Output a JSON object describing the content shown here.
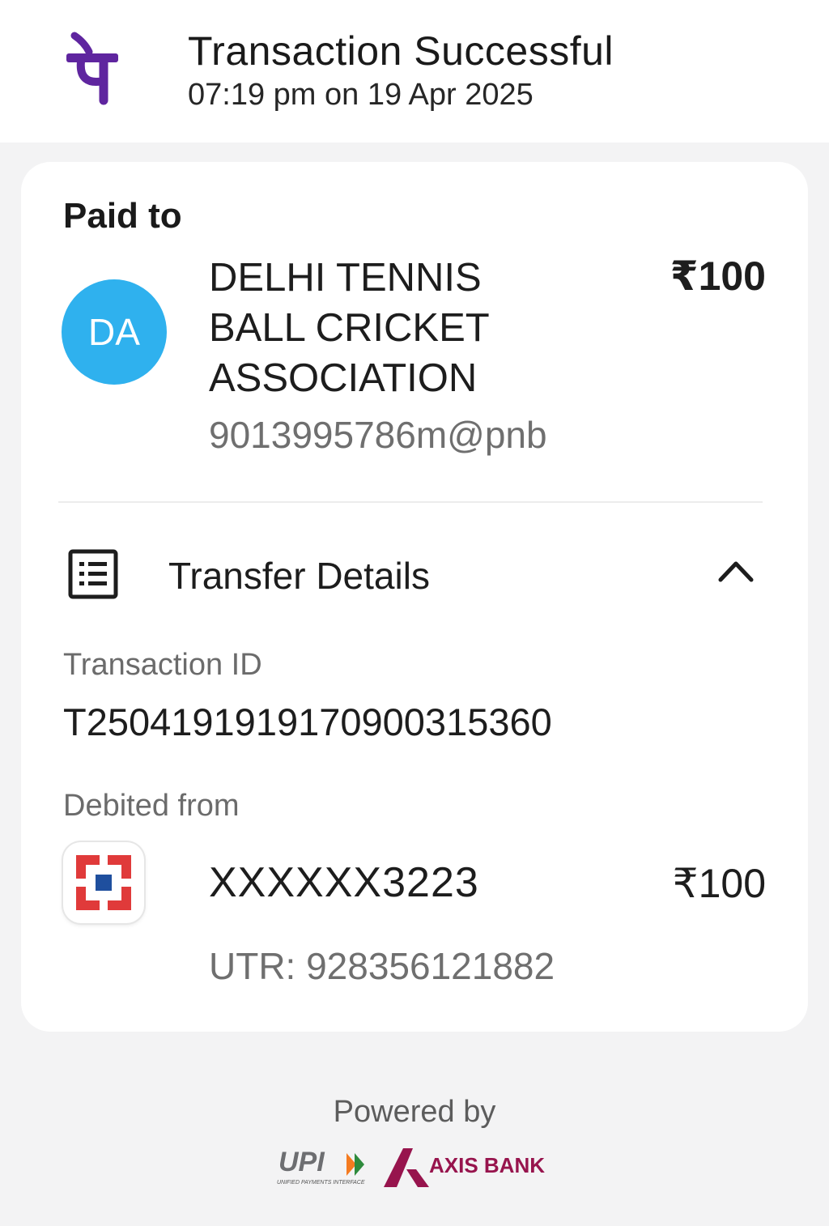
{
  "header": {
    "title": "Transaction Successful",
    "subtitle": "07:19 pm on 19 Apr 2025",
    "logo_icon": "phonepe-logo",
    "brand_color": "#5f259f"
  },
  "payment": {
    "paid_to_label": "Paid to",
    "avatar_initials": "DA",
    "avatar_color": "#2fb1ee",
    "payee_name": "DELHI TENNIS BALL CRICKET ASSOCIATION",
    "payee_upi": "9013995786m@pnb",
    "amount": "₹100"
  },
  "transfer_details": {
    "label": "Transfer Details",
    "icon": "receipt-list-icon",
    "toggle_icon": "chevron-up-icon",
    "transaction_id_label": "Transaction ID",
    "transaction_id": "T2504191919170900315360",
    "debited_from_label": "Debited from",
    "bank_icon": "bank-logo",
    "account_number": "XXXXXX3223",
    "debited_amount": "₹100",
    "utr": "UTR: 928356121882"
  },
  "footer": {
    "powered_by": "Powered by",
    "upi_logo": "UPI",
    "upi_tagline": "UNIFIED PAYMENTS INTERFACE",
    "bank_partner": "AXIS BANK"
  }
}
